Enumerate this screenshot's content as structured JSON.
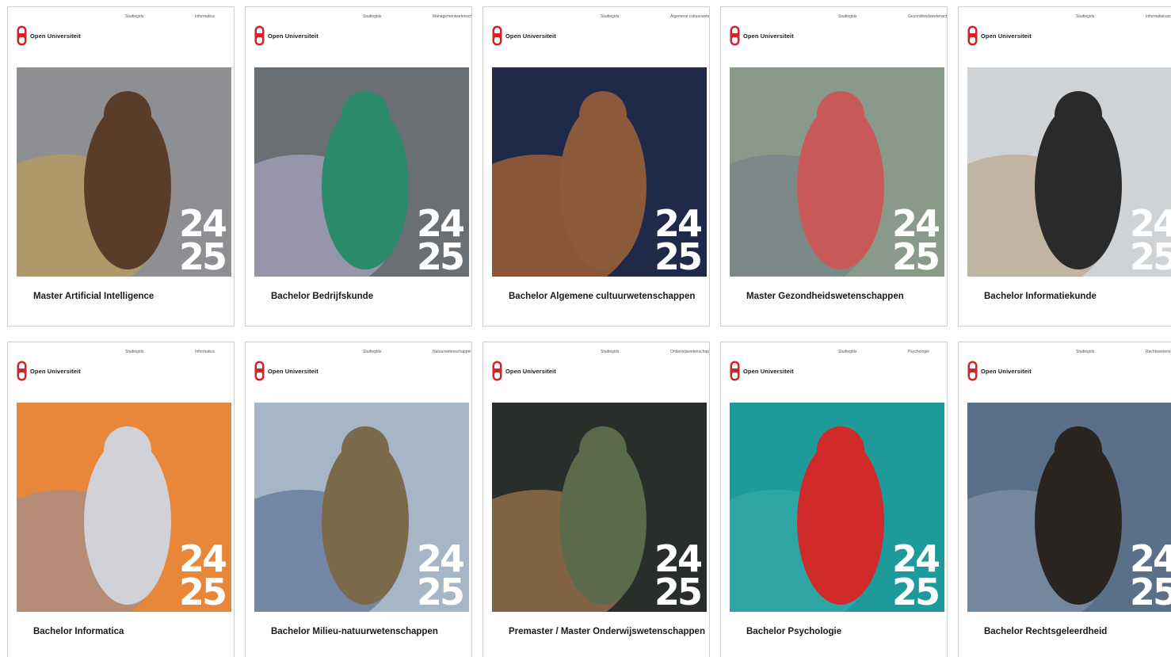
{
  "brand": {
    "logo_text": "Open Universiteit",
    "logo_color": "#d3232a"
  },
  "year_top": "24",
  "year_bottom": "25",
  "cards": [
    {
      "meta1": "Studiegids",
      "meta2": "Informatica",
      "title": "Master Artificial Intelligence",
      "photo": "woman-face-scan",
      "colors": [
        "#8e8f92",
        "#c9a24a",
        "#5a3c2a"
      ]
    },
    {
      "meta1": "Studiegids",
      "meta2": "Managementwetenschappen",
      "title": "Bachelor Bedrijfskunde",
      "photo": "woman-coffee-blazer",
      "colors": [
        "#6a6f74",
        "#b9b5d6",
        "#2a8a6a"
      ]
    },
    {
      "meta1": "Studiegids",
      "meta2": "Algemene cultuurwetenschappen",
      "title": "Bachelor Algemene cultuurwetenschappen",
      "photo": "night-street-light-trails",
      "colors": [
        "#1f2a4a",
        "#e07a2a",
        "#8a5a3a"
      ]
    },
    {
      "meta1": "Studiegids",
      "meta2": "Gezondheidswetenschappen",
      "title": "Master Gezondheidswetenschappen",
      "photo": "runners-street",
      "colors": [
        "#8a9a8a",
        "#6e7b86",
        "#c85a5a"
      ]
    },
    {
      "meta1": "Studiegids",
      "meta2": "Informatiekunde",
      "title": "Bachelor Informatiekunde",
      "photo": "woman-hat-whiteboard",
      "colors": [
        "#cfd3d6",
        "#b89a78",
        "#2a2a2a"
      ]
    },
    {
      "meta1": "Studiegids",
      "meta2": "Informatica",
      "title": "Bachelor Informatica",
      "photo": "man-vr-egg-chair",
      "colors": [
        "#e8863a",
        "#8a8fa6",
        "#d0d2d8"
      ]
    },
    {
      "meta1": "Studiegids",
      "meta2": "Natuurwetenschappen",
      "title": "Bachelor Milieu-natuurwetenschappen",
      "photo": "women-water-field",
      "colors": [
        "#a6b6c6",
        "#4a5e8a",
        "#7a6a4a"
      ]
    },
    {
      "meta1": "Studiegids",
      "meta2": "Onderwijswetenschappen",
      "title": "Premaster / Master Onderwijswetenschappen",
      "photo": "raised-hands",
      "colors": [
        "#2a2e2a",
        "#c8905a",
        "#5a6a4a"
      ]
    },
    {
      "meta1": "Studiegids",
      "meta2": "Psychologie",
      "title": "Bachelor Psychologie",
      "photo": "swimmer-turquoise-water",
      "colors": [
        "#1f9a9a",
        "#3ab0b0",
        "#d02a2a"
      ]
    },
    {
      "meta1": "Studiegids",
      "meta2": "Rechtswetenschappen",
      "title": "Bachelor Rechtsgeleerdheid",
      "photo": "woman-arms-crossed-city",
      "colors": [
        "#5a7088",
        "#8a9aae",
        "#2a2420"
      ]
    }
  ]
}
